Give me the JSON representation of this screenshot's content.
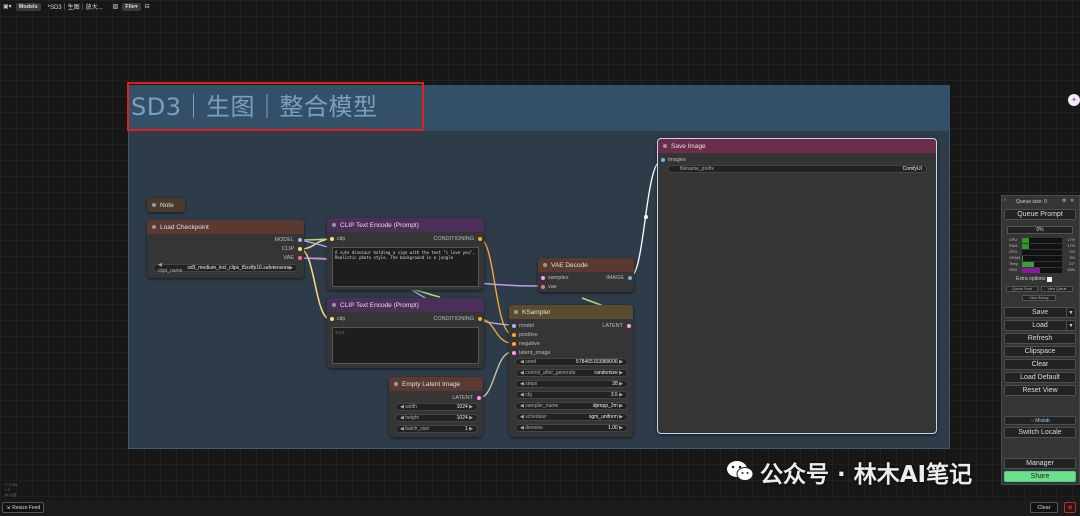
{
  "toolbar": {
    "models_label": "Models",
    "workflow_title": "*SD3｜生图｜放大...",
    "file_label": "File"
  },
  "group": {
    "title": "SD3｜生图｜整合模型"
  },
  "note": {
    "title": "Note"
  },
  "load_checkpoint": {
    "title": "Load Checkpoint",
    "outputs": [
      "MODEL",
      "CLIP",
      "VAE"
    ],
    "ckpt_label": "ckpt_name",
    "ckpt_value": "sd3_medium_incl_clips_t5xxlfp16.safetensors"
  },
  "clip_pos": {
    "title": "CLIP Text Encode (Prompt)",
    "input": "clip",
    "output": "CONDITIONING",
    "text": "A cute dinosaur holding a sign with the text \"i love you\", Realistic photo style. The background is a jungle"
  },
  "clip_neg": {
    "title": "CLIP Text Encode (Prompt)",
    "input": "clip",
    "output": "CONDITIONING",
    "text": "text"
  },
  "vae_decode": {
    "title": "VAE Decode",
    "inputs": [
      "samples",
      "vae"
    ],
    "output": "IMAGE"
  },
  "ksampler": {
    "title": "KSampler",
    "inputs": [
      "model",
      "positive",
      "negative",
      "latent_image"
    ],
    "output": "LATENT",
    "widgets": [
      {
        "label": "seed",
        "value": "578465153989006"
      },
      {
        "label": "control_after_generate",
        "value": "randomize"
      },
      {
        "label": "steps",
        "value": "28"
      },
      {
        "label": "cfg",
        "value": "3.5"
      },
      {
        "label": "sampler_name",
        "value": "dpmpp_2m"
      },
      {
        "label": "scheduler",
        "value": "sgm_uniform"
      },
      {
        "label": "denoise",
        "value": "1.00"
      }
    ]
  },
  "empty_latent": {
    "title": "Empty Latent Image",
    "output": "LATENT",
    "widgets": [
      {
        "label": "width",
        "value": "1024"
      },
      {
        "label": "height",
        "value": "1024"
      },
      {
        "label": "batch_size",
        "value": "1"
      }
    ]
  },
  "save_image": {
    "title": "Save Image",
    "input": "images",
    "prefix_label": "filename_prefix",
    "prefix_value": "ComfyUI"
  },
  "panel": {
    "queue_size": "Queue size: 0",
    "queue_prompt": "Queue Prompt",
    "progress": "0%",
    "stats": [
      {
        "label": "CPU",
        "value": "17%",
        "fill": 0.17,
        "color": "#2a9a2a"
      },
      {
        "label": "RAM",
        "value": "17%",
        "fill": 0.17,
        "color": "#2a9a2a"
      },
      {
        "label": "GPU",
        "value": "0%",
        "fill": 0.0,
        "color": "#2a9a2a"
      },
      {
        "label": "VRAM",
        "value": "3%",
        "fill": 0.03,
        "color": "#2a9a2a"
      },
      {
        "label": "Temp",
        "value": "31°",
        "fill": 0.31,
        "color": "#3aa03a"
      },
      {
        "label": "HDD",
        "value": "46%",
        "fill": 0.46,
        "color": "#8a1a9a"
      }
    ],
    "extra_options": "Extra options",
    "queue_front": "Queue Front",
    "view_queue": "View Queue",
    "view_history": "View History",
    "buttons": [
      "Save",
      "Load",
      "Refresh",
      "Clipspace",
      "Clear",
      "Load Default",
      "Reset View"
    ],
    "mixlab": "Mixlab",
    "switch_locale": "Switch Locale",
    "manager": "Manager",
    "share": "Share"
  },
  "bottom": {
    "resize_feed": "Resize Feed",
    "clear": "Clear",
    "stats_lines": [
      "T: 0.00s",
      "I: 0",
      "N: 0 [0]"
    ]
  },
  "watermark": "公众号 · 林木AI笔记",
  "colors": {
    "group_bg": "#2e3c4a",
    "highlight_box": "#e02020",
    "share_btn": "#6fe08a"
  }
}
